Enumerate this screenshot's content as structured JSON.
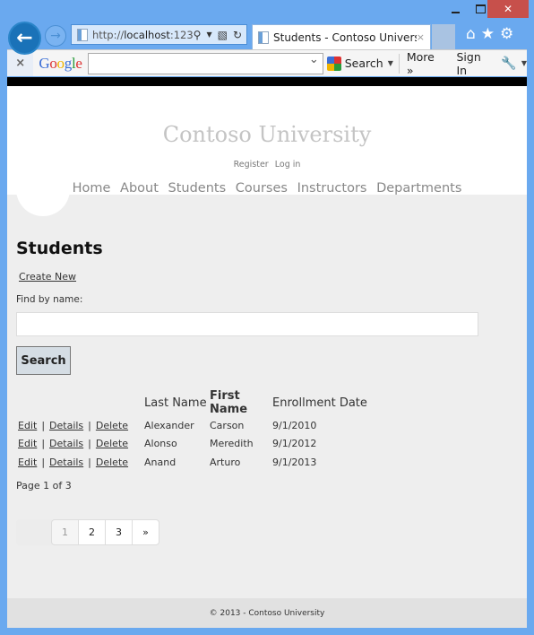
{
  "browser": {
    "address_url_prefix": "http://",
    "address_url_host": "localhost",
    "address_url_suffix": ":123",
    "tab_title": "Students - Contoso Univers...",
    "tab_close": "×",
    "window_close": "✕",
    "icons": {
      "home": "⌂",
      "favorites": "★",
      "settings": "⚙"
    },
    "toolbar": {
      "close": "×",
      "google_letters": [
        "G",
        "o",
        "o",
        "g",
        "l",
        "e"
      ],
      "search_value": "",
      "search_label": "Search",
      "more_label": "More »",
      "signin_label": "Sign In",
      "wrench": "🔧"
    }
  },
  "site": {
    "title": "Contoso University",
    "auth_links": [
      "Register",
      "Log in"
    ],
    "nav": [
      "Home",
      "About",
      "Students",
      "Courses",
      "Instructors",
      "Departments"
    ],
    "footer": "© 2013 - Contoso University"
  },
  "page": {
    "heading": "Students",
    "create_new": "Create New",
    "find_label": "Find by name:",
    "find_value": "",
    "search_button": "Search",
    "table": {
      "headers": [
        "Last Name",
        "First Name",
        "Enrollment Date"
      ],
      "action_labels": [
        "Edit",
        "Details",
        "Delete"
      ],
      "rows": [
        {
          "last": "Alexander",
          "first": "Carson",
          "date": "9/1/2010"
        },
        {
          "last": "Alonso",
          "first": "Meredith",
          "date": "9/1/2012"
        },
        {
          "last": "Anand",
          "first": "Arturo",
          "date": "9/1/2013"
        }
      ]
    },
    "page_info": "Page 1 of 3",
    "pager": [
      "1",
      "2",
      "3",
      "»"
    ],
    "current_page": 1
  }
}
